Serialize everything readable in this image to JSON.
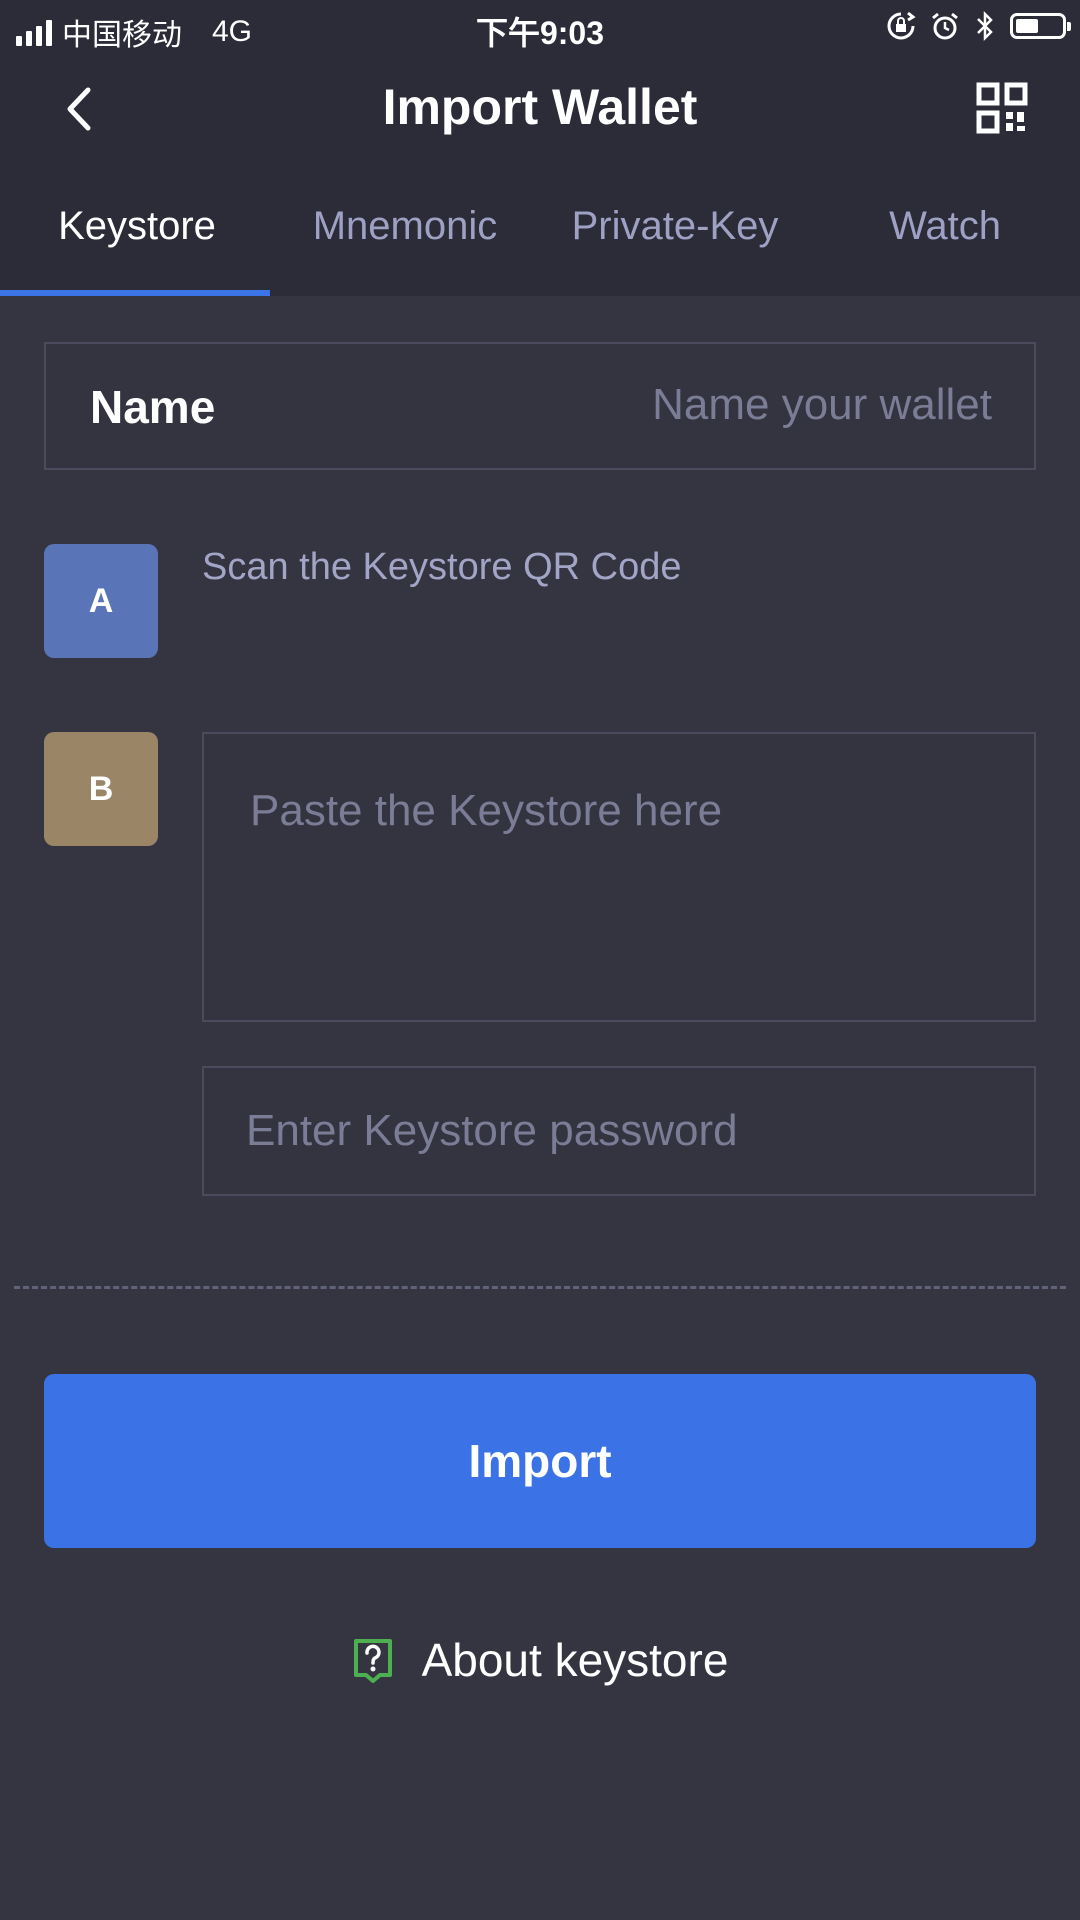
{
  "status_bar": {
    "carrier": "中国移动",
    "network": "4G",
    "time": "下午9:03",
    "battery_level": 0.5
  },
  "header": {
    "title": "Import Wallet",
    "back_icon": "chevron-left-icon",
    "qr_icon": "qr-code-icon"
  },
  "tabs": [
    {
      "label": "Keystore",
      "active": true
    },
    {
      "label": "Mnemonic",
      "active": false
    },
    {
      "label": "Private-Key",
      "active": false
    },
    {
      "label": "Watch",
      "active": false
    }
  ],
  "form": {
    "name_label": "Name",
    "name_placeholder": "Name your wallet",
    "step_a": "A",
    "scan_text": "Scan the Keystore QR Code",
    "step_b": "B",
    "keystore_placeholder": "Paste the Keystore here",
    "password_placeholder": "Enter Keystore password"
  },
  "import_button": "Import",
  "about_link": "About keystore",
  "colors": {
    "accent": "#3b73e6",
    "badge_a": "#5a74b8",
    "badge_b": "#9a8566",
    "help_icon": "#4caf50",
    "background": "#343541",
    "header_background": "#2b2c37"
  }
}
